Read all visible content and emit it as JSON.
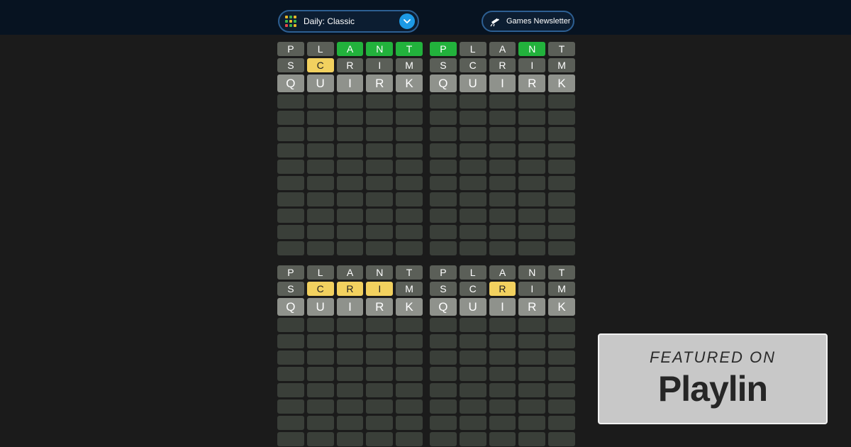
{
  "header": {
    "mode_label": "Daily: Classic",
    "newsletter_label": "Games Newsletter",
    "mode_icon_colors": [
      "#e8b627",
      "#3db449",
      "#e8b627",
      "#3db449",
      "#e8b627",
      "#3db449",
      "#e84a4a",
      "#3db449",
      "#e8b627"
    ]
  },
  "colors": {
    "green": "#22b23c",
    "yellow": "#f2d15f",
    "gray": "#5b5f58",
    "light": "#8f928c",
    "empty": "#3a3f39",
    "accent": "#1d9ae6"
  },
  "boards": [
    {
      "guesses": [
        {
          "letters": [
            "P",
            "L",
            "A",
            "N",
            "T"
          ],
          "states": [
            "gray",
            "gray",
            "green",
            "green",
            "green"
          ]
        },
        {
          "letters": [
            "S",
            "C",
            "R",
            "I",
            "M"
          ],
          "states": [
            "gray",
            "yellow",
            "gray",
            "gray",
            "gray"
          ]
        },
        {
          "letters": [
            "Q",
            "U",
            "I",
            "R",
            "K"
          ],
          "states": [
            "light",
            "light",
            "light",
            "light",
            "light"
          ]
        }
      ],
      "empty_rows": 10
    },
    {
      "guesses": [
        {
          "letters": [
            "P",
            "L",
            "A",
            "N",
            "T"
          ],
          "states": [
            "green",
            "gray",
            "gray",
            "green",
            "gray"
          ]
        },
        {
          "letters": [
            "S",
            "C",
            "R",
            "I",
            "M"
          ],
          "states": [
            "gray",
            "gray",
            "gray",
            "gray",
            "gray"
          ]
        },
        {
          "letters": [
            "Q",
            "U",
            "I",
            "R",
            "K"
          ],
          "states": [
            "light",
            "light",
            "light",
            "light",
            "light"
          ]
        }
      ],
      "empty_rows": 10
    },
    {
      "guesses": [
        {
          "letters": [
            "P",
            "L",
            "A",
            "N",
            "T"
          ],
          "states": [
            "gray",
            "gray",
            "gray",
            "gray",
            "gray"
          ]
        },
        {
          "letters": [
            "S",
            "C",
            "R",
            "I",
            "M"
          ],
          "states": [
            "gray",
            "yellow",
            "yellow",
            "yellow",
            "gray"
          ]
        },
        {
          "letters": [
            "Q",
            "U",
            "I",
            "R",
            "K"
          ],
          "states": [
            "light",
            "light",
            "light",
            "light",
            "light"
          ]
        }
      ],
      "empty_rows": 8
    },
    {
      "guesses": [
        {
          "letters": [
            "P",
            "L",
            "A",
            "N",
            "T"
          ],
          "states": [
            "gray",
            "gray",
            "gray",
            "gray",
            "gray"
          ]
        },
        {
          "letters": [
            "S",
            "C",
            "R",
            "I",
            "M"
          ],
          "states": [
            "gray",
            "gray",
            "yellow",
            "gray",
            "gray"
          ]
        },
        {
          "letters": [
            "Q",
            "U",
            "I",
            "R",
            "K"
          ],
          "states": [
            "light",
            "light",
            "light",
            "light",
            "light"
          ]
        }
      ],
      "empty_rows": 8
    }
  ],
  "featured": {
    "top_text": "FEATURED ON",
    "brand": "Playlin"
  }
}
